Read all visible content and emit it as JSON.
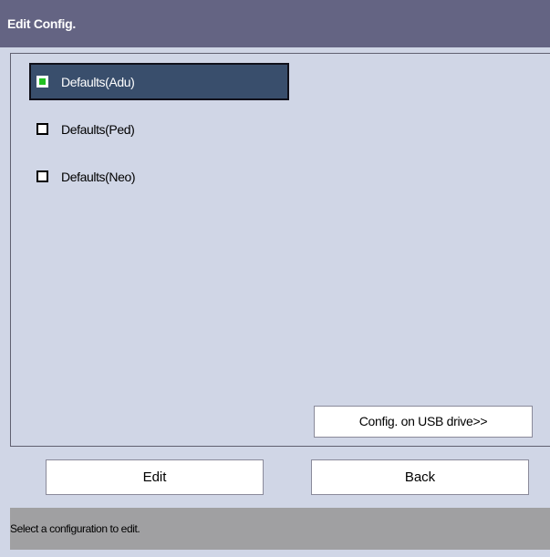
{
  "window": {
    "title": "Edit Config."
  },
  "configs": [
    {
      "label": "Defaults(Adu)",
      "selected": true
    },
    {
      "label": "Defaults(Ped)",
      "selected": false
    },
    {
      "label": "Defaults(Neo)",
      "selected": false
    }
  ],
  "buttons": {
    "usb_label": "Config. on USB drive>>",
    "edit_label": "Edit",
    "back_label": "Back"
  },
  "status": {
    "message": "Select a configuration to edit."
  },
  "colors": {
    "title_bar": "#646483",
    "panel_bg": "#d0d6e6",
    "selected_item": "#394e6c",
    "checkbox_active": "#22c022",
    "status_bar": "#a0a0a2"
  }
}
